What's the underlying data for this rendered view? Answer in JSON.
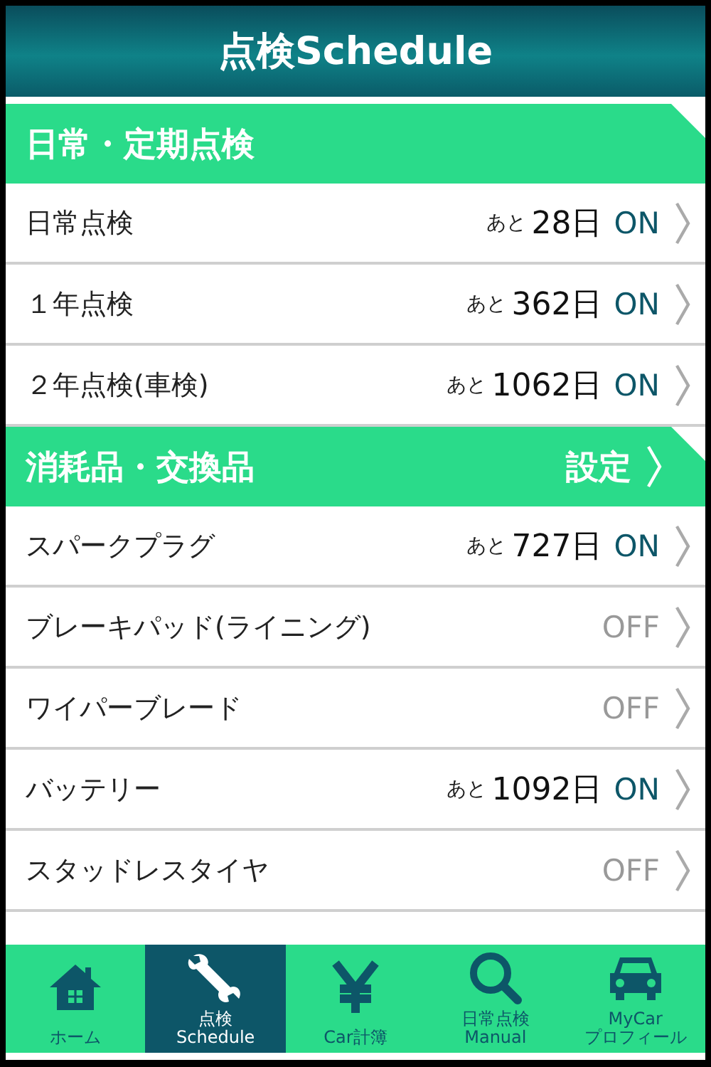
{
  "header": {
    "title": "点検Schedule"
  },
  "sections": [
    {
      "title": "日常・定期点検",
      "items": [
        {
          "name": "日常点検",
          "prefix": "あと",
          "days": "28日",
          "status": "ON",
          "on": true
        },
        {
          "name": "１年点検",
          "prefix": "あと",
          "days": "362日",
          "status": "ON",
          "on": true
        },
        {
          "name": "２年点検(車検)",
          "prefix": "あと",
          "days": "1062日",
          "status": "ON",
          "on": true
        }
      ]
    },
    {
      "title": "消耗品・交換品",
      "action": "設定",
      "items": [
        {
          "name": "スパークプラグ",
          "prefix": "あと",
          "days": "727日",
          "status": "ON",
          "on": true
        },
        {
          "name": "ブレーキパッド(ライニング)",
          "status": "OFF",
          "on": false
        },
        {
          "name": "ワイパーブレード",
          "status": "OFF",
          "on": false
        },
        {
          "name": "バッテリー",
          "prefix": "あと",
          "days": "1092日",
          "status": "ON",
          "on": true
        },
        {
          "name": "スタッドレスタイヤ",
          "status": "OFF",
          "on": false
        }
      ]
    }
  ],
  "tab_bar": [
    {
      "kind": "home",
      "lines": [
        "ホーム"
      ],
      "selected": false
    },
    {
      "kind": "wrench",
      "lines": [
        "点検",
        "Schedule"
      ],
      "selected": true
    },
    {
      "kind": "yen",
      "lines": [
        "Car計簿"
      ],
      "selected": false
    },
    {
      "kind": "search",
      "lines": [
        "日常点検",
        "Manual"
      ],
      "selected": false
    },
    {
      "kind": "car",
      "lines": [
        "MyCar",
        "プロフィール"
      ],
      "selected": false
    }
  ]
}
